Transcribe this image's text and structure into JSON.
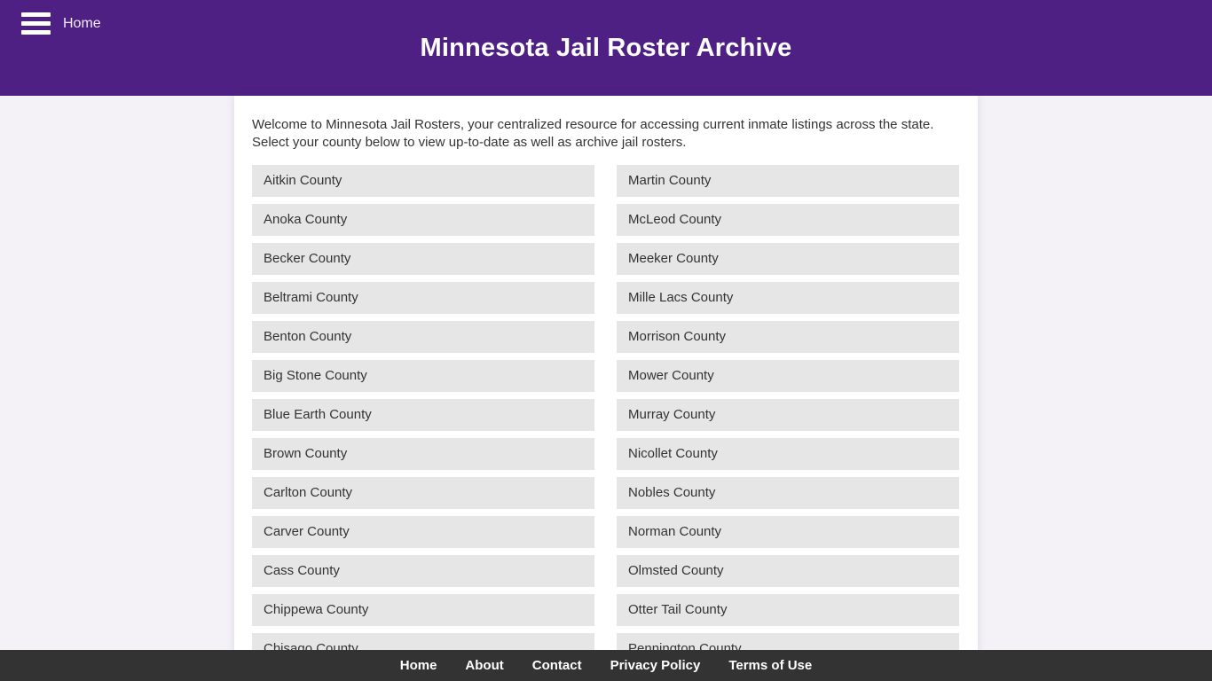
{
  "header": {
    "nav_home_label": "Home",
    "menu_icon": "hamburger-menu-icon",
    "title": "Minnesota Jail Roster Archive",
    "background_color": "#4f2083",
    "title_color": "#ffffff"
  },
  "main": {
    "intro": "Welcome to Minnesota Jail Rosters, your centralized resource for accessing current inmate listings across the state. Select your county below to view up-to-date as well as archive jail rosters.",
    "item_background_color": "#e6e6e6",
    "card_background_color": "#ffffff",
    "page_background_color": "#f4f2f7",
    "counties_left": [
      "Aitkin County",
      "Anoka County",
      "Becker County",
      "Beltrami County",
      "Benton County",
      "Big Stone County",
      "Blue Earth County",
      "Brown County",
      "Carlton County",
      "Carver County",
      "Cass County",
      "Chippewa County",
      "Chisago County"
    ],
    "counties_right": [
      "Martin County",
      "McLeod County",
      "Meeker County",
      "Mille Lacs County",
      "Morrison County",
      "Mower County",
      "Murray County",
      "Nicollet County",
      "Nobles County",
      "Norman County",
      "Olmsted County",
      "Otter Tail County",
      "Pennington County"
    ]
  },
  "footer": {
    "background_color": "#333333",
    "links": [
      "Home",
      "About",
      "Contact",
      "Privacy Policy",
      "Terms of Use"
    ]
  }
}
